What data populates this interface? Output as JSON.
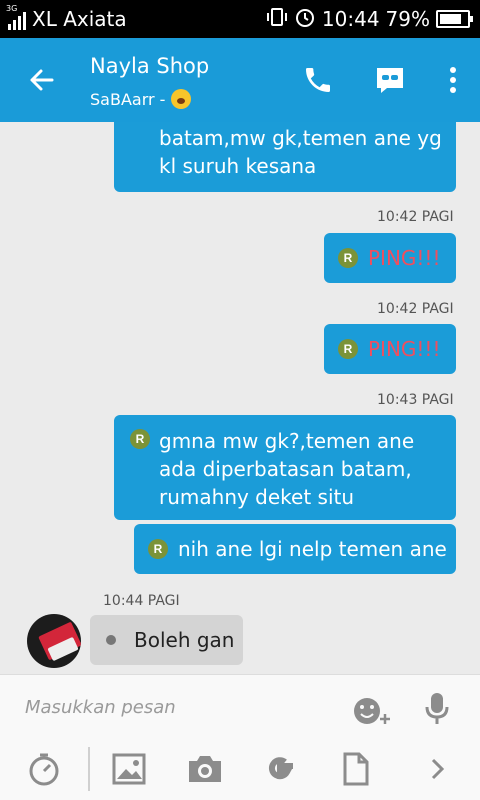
{
  "status_bar": {
    "network": "3G",
    "carrier": "XL Axiata",
    "time": "10:44",
    "battery_percent": "79%",
    "battery_level": 0.79,
    "icons": [
      "signal-icon",
      "vibrate-icon",
      "alarm-icon",
      "battery-icon"
    ]
  },
  "header": {
    "title": "Nayla Shop",
    "subtitle": "SaBAarr -",
    "icons": [
      "back-arrow-icon",
      "phone-icon",
      "video-chat-icon",
      "more-vert-icon"
    ],
    "color": "#1a9bd8"
  },
  "messages": {
    "m1": {
      "lines": [
        "batam,mw gk,temen ane yg",
        "kl suruh kesana"
      ]
    },
    "t2": "10:42 PAGI",
    "m2": {
      "badge": "R",
      "text": "PING!!!"
    },
    "t3": "10:42 PAGI",
    "m3": {
      "badge": "R",
      "text": "PING!!!"
    },
    "t4": "10:43 PAGI",
    "m4": {
      "badge": "R",
      "lines": [
        "gmna mw gk?,temen ane",
        "ada diperbatasan batam,",
        "rumahny deket situ"
      ]
    },
    "m5": {
      "badge": "R",
      "text": "nih ane lgi nelp temen ane"
    },
    "t6": "10:44 PAGI",
    "m6": {
      "text": "Boleh gan"
    }
  },
  "composer": {
    "placeholder": "Masukkan pesan",
    "icons": [
      "sticker-add-icon",
      "mic-icon"
    ]
  },
  "toolbar": {
    "icons": [
      "timer-icon",
      "image-icon",
      "camera-icon",
      "gif-icon",
      "file-icon",
      "chevron-right-icon"
    ]
  },
  "colors": {
    "outgoing_bubble": "#1b9cd8",
    "incoming_bubble": "#d4d4d4",
    "ping_text": "#ef4f5f",
    "badge": "#7b9338",
    "background": "#ebebeb"
  }
}
